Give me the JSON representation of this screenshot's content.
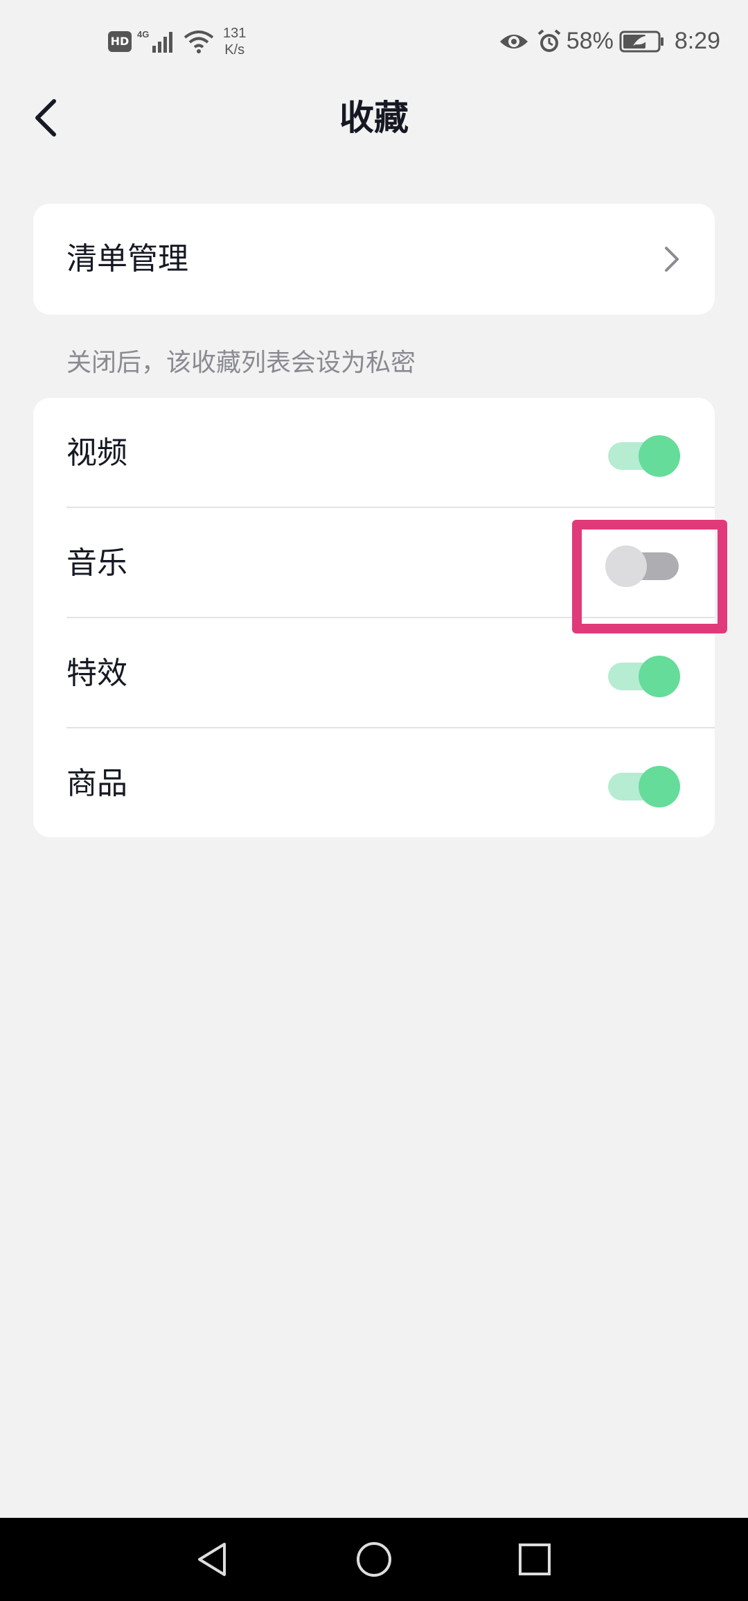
{
  "status_bar": {
    "hd": "HD",
    "net_speed_value": "131",
    "net_speed_unit": "K/s",
    "battery": "58%",
    "time": "8:29"
  },
  "header": {
    "title": "收藏"
  },
  "list_manage": {
    "label": "清单管理"
  },
  "hint": "关闭后，该收藏列表会设为私密",
  "toggles": [
    {
      "label": "视频",
      "on": true
    },
    {
      "label": "音乐",
      "on": false
    },
    {
      "label": "特效",
      "on": true
    },
    {
      "label": "商品",
      "on": true
    }
  ],
  "colors": {
    "toggle_on_knob": "#65dc9a",
    "toggle_on_track": "#b5ecd2",
    "toggle_off_knob": "#dcdcde",
    "toggle_off_track": "#aeaeb2",
    "highlight": "#e03a7a"
  }
}
